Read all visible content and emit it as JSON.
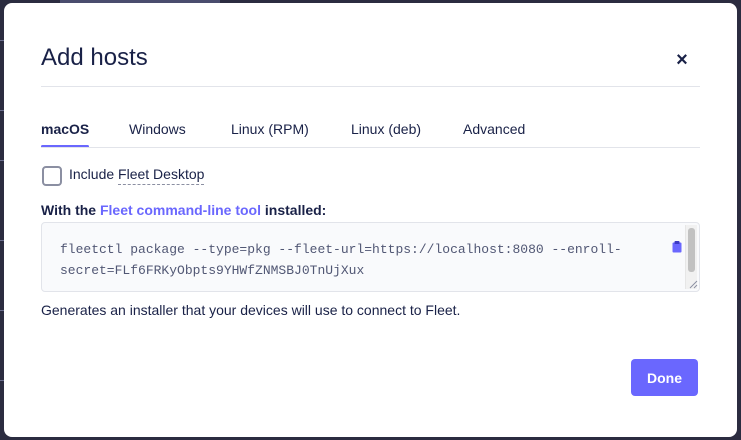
{
  "modal": {
    "title": "Add hosts",
    "close_glyph": "×"
  },
  "tabs": [
    {
      "label": "macOS",
      "active": true
    },
    {
      "label": "Windows",
      "active": false
    },
    {
      "label": "Linux (RPM)",
      "active": false
    },
    {
      "label": "Linux (deb)",
      "active": false
    },
    {
      "label": "Advanced",
      "active": false
    }
  ],
  "options": {
    "include_prefix": "Include ",
    "include_term": "Fleet Desktop",
    "include_checked": false
  },
  "cli": {
    "heading_prefix": "With the ",
    "heading_link": "Fleet command-line tool",
    "heading_suffix": " installed:",
    "command": "fleetctl package --type=pkg --fleet-url=https://localhost:8080 --enroll-secret=FLf6FRKyObpts9YHWfZNMSBJ0TnUjXux",
    "copy_icon": "clipboard-icon"
  },
  "description": "Generates an installer that your devices will use to connect to Fleet.",
  "footer": {
    "done_label": "Done"
  },
  "colors": {
    "accent": "#6a67fe",
    "text": "#192147",
    "code_text": "#515774"
  }
}
